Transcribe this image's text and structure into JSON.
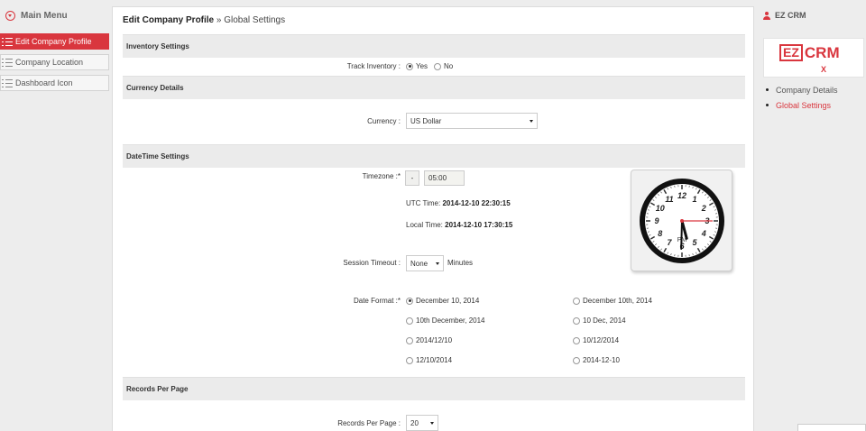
{
  "sidebar": {
    "title": "Main Menu",
    "items": [
      {
        "label": "Edit Company Profile",
        "active": true
      },
      {
        "label": "Company Location",
        "active": false
      },
      {
        "label": "Dashboard Icon",
        "active": false
      }
    ]
  },
  "breadcrumb": {
    "section": "Edit Company Profile",
    "separator": " » ",
    "page": "Global Settings"
  },
  "inventory": {
    "heading": "Inventory Settings",
    "track_label": "Track Inventory :",
    "options": [
      {
        "label": "Yes",
        "checked": true
      },
      {
        "label": "No",
        "checked": false
      }
    ]
  },
  "currency": {
    "heading": "Currency Details",
    "label": "Currency :",
    "value": "US Dollar"
  },
  "datetime": {
    "heading": "DateTime Settings",
    "timezone_label": "Timezone :*",
    "timezone_sign": "-",
    "timezone_value": "05:00",
    "utc_label": "UTC Time:",
    "utc_value": "2014-12-10 22:30:15",
    "local_label": "Local Time:",
    "local_value": "2014-12-10 17:30:15",
    "session_label": "Session Timeout :",
    "session_value": "None",
    "session_unit": "Minutes",
    "date_format_label": "Date Format :*",
    "date_formats": [
      {
        "label": "December 10, 2014",
        "checked": true
      },
      {
        "label": "December 10th, 2014",
        "checked": false
      },
      {
        "label": "10th December, 2014",
        "checked": false
      },
      {
        "label": "10 Dec, 2014",
        "checked": false
      },
      {
        "label": "2014/12/10",
        "checked": false
      },
      {
        "label": "10/12/2014",
        "checked": false
      },
      {
        "label": "12/10/2014",
        "checked": false
      },
      {
        "label": "2014-12-10",
        "checked": false
      }
    ],
    "clock": {
      "numerals": [
        "12",
        "1",
        "2",
        "3",
        "4",
        "5",
        "6",
        "7",
        "8",
        "9",
        "10",
        "11"
      ],
      "meridiem": "PM",
      "hour": 5,
      "minute": 30,
      "second": 15
    }
  },
  "records": {
    "heading": "Records Per Page",
    "label": "Records Per Page :",
    "value": "20"
  },
  "right_panel": {
    "user": "EZ CRM",
    "logo_boxed": "EZ",
    "logo_text": "CRM",
    "logo_mark": "X",
    "links": [
      {
        "label": "Company Details",
        "active": false
      },
      {
        "label": "Global Settings",
        "active": true
      }
    ]
  },
  "colors": {
    "accent": "#d9363e",
    "section_bg": "#ebebeb",
    "page_bg": "#ededed"
  }
}
